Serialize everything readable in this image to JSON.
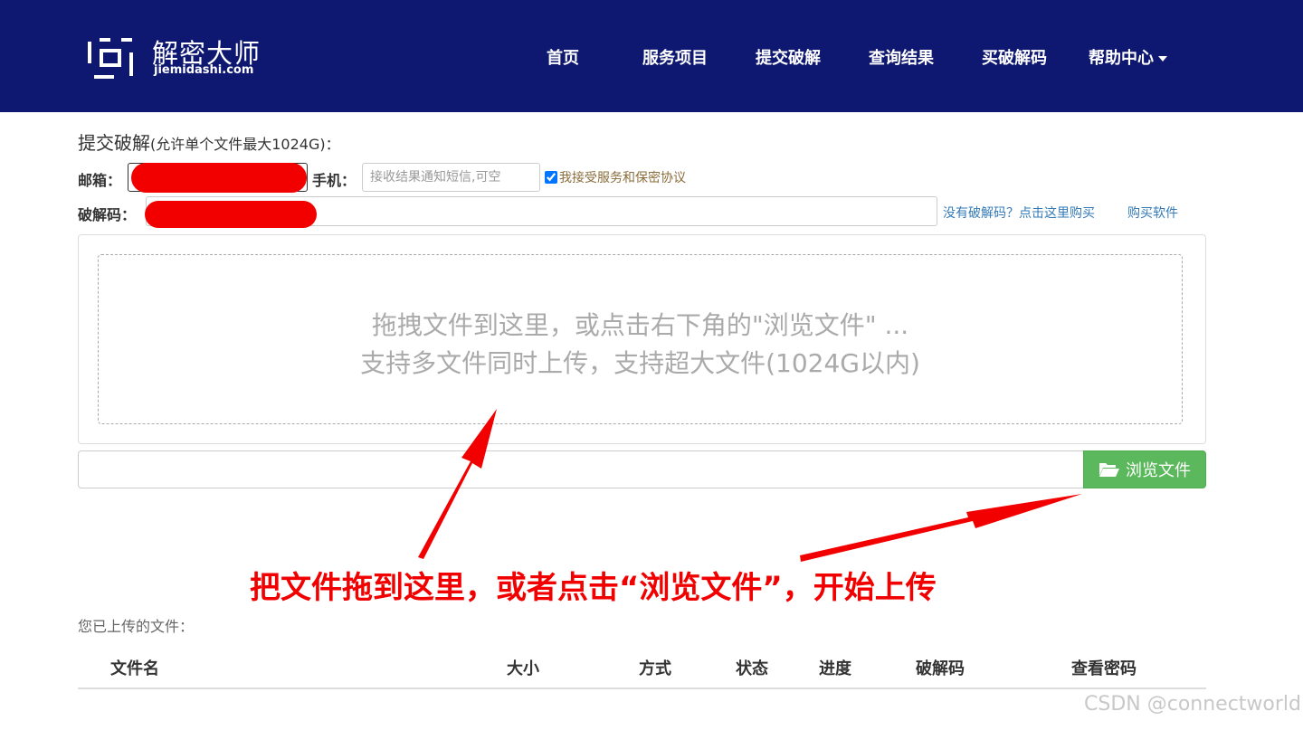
{
  "header": {
    "logo_title": "解密大师",
    "logo_sub": "jiemidashi.com",
    "nav": [
      "首页",
      "服务项目",
      "提交破解",
      "查询结果",
      "买破解码",
      "帮助中心"
    ]
  },
  "form": {
    "title": "提交破解",
    "title_note": "(允许单个文件最大1024G)：",
    "email_label": "邮箱：",
    "phone_label": "手机：",
    "phone_placeholder": "接收结果通知短信,可空",
    "agree_label": "我接受服务和保密协议",
    "code_label": "破解码：",
    "no_code_link": "没有破解码？点击这里购买",
    "buy_software_link": "购买软件"
  },
  "dropzone": {
    "line1": "拖拽文件到这里，或点击右下角的\"浏览文件\" ...",
    "line2": "支持多文件同时上传，支持超大文件(1024G以内)"
  },
  "browse": {
    "label": "浏览文件"
  },
  "annotation": "把文件拖到这里，或者点击“浏览文件”，开始上传",
  "uploaded": {
    "title": "您已上传的文件：",
    "columns": [
      "文件名",
      "大小",
      "方式",
      "状态",
      "进度",
      "破解码",
      "查看密码"
    ]
  },
  "watermark": "CSDN @connectworld",
  "colors": {
    "header_bg": "#0e1870",
    "browse_bg": "#5cb85c",
    "annotation": "#f20000"
  }
}
